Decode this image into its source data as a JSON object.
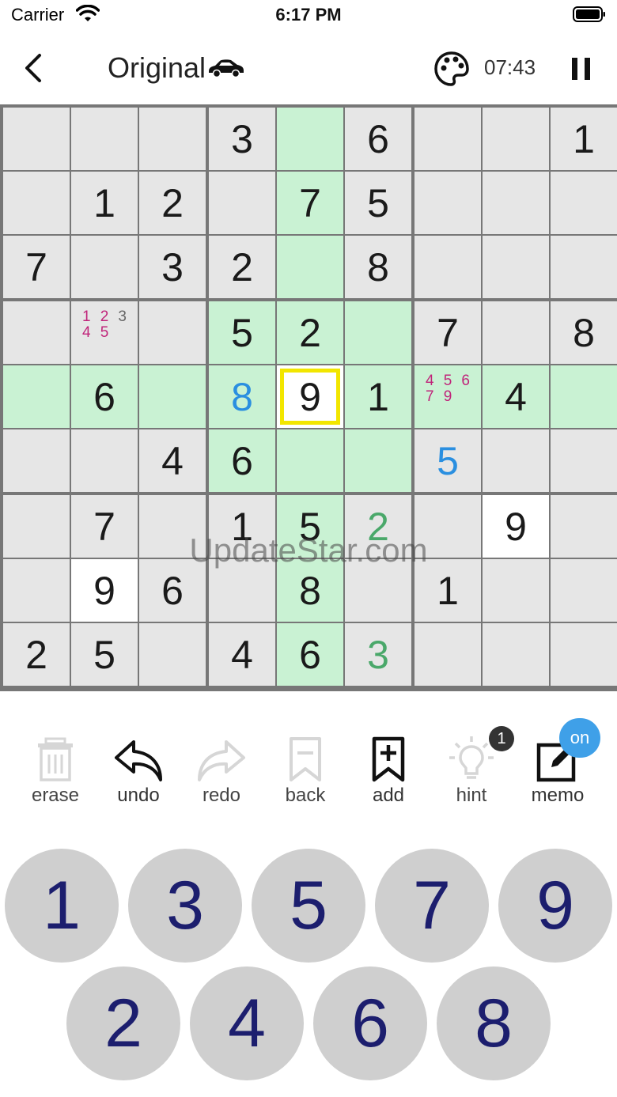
{
  "status_bar": {
    "carrier": "Carrier",
    "time": "6:17 PM"
  },
  "header": {
    "title": "Original",
    "timer": "07:43"
  },
  "board": {
    "rows": [
      [
        {
          "v": ""
        },
        {
          "v": ""
        },
        {
          "v": ""
        },
        {
          "v": "3"
        },
        {
          "v": ""
        },
        {
          "v": "6"
        },
        {
          "v": ""
        },
        {
          "v": ""
        },
        {
          "v": "1"
        }
      ],
      [
        {
          "v": ""
        },
        {
          "v": "1"
        },
        {
          "v": "2"
        },
        {
          "v": ""
        },
        {
          "v": "7"
        },
        {
          "v": "5"
        },
        {
          "v": ""
        },
        {
          "v": ""
        },
        {
          "v": ""
        }
      ],
      [
        {
          "v": "7"
        },
        {
          "v": ""
        },
        {
          "v": "3"
        },
        {
          "v": "2"
        },
        {
          "v": ""
        },
        {
          "v": "8"
        },
        {
          "v": ""
        },
        {
          "v": ""
        },
        {
          "v": ""
        }
      ],
      [
        {
          "v": ""
        },
        {
          "v": "",
          "notes": [
            "1",
            "2",
            "3",
            "4",
            "5"
          ]
        },
        {
          "v": ""
        },
        {
          "v": "5"
        },
        {
          "v": "2"
        },
        {
          "v": ""
        },
        {
          "v": "7"
        },
        {
          "v": ""
        },
        {
          "v": "8"
        }
      ],
      [
        {
          "v": ""
        },
        {
          "v": "6"
        },
        {
          "v": ""
        },
        {
          "v": "8",
          "c": "blue"
        },
        {
          "v": "9",
          "sel": true
        },
        {
          "v": "1"
        },
        {
          "v": "",
          "notes": [
            "4",
            "5",
            "6",
            "7",
            "9"
          ]
        },
        {
          "v": "4"
        },
        {
          "v": ""
        }
      ],
      [
        {
          "v": ""
        },
        {
          "v": ""
        },
        {
          "v": "4"
        },
        {
          "v": "6"
        },
        {
          "v": ""
        },
        {
          "v": ""
        },
        {
          "v": "5",
          "c": "blue"
        },
        {
          "v": ""
        },
        {
          "v": ""
        }
      ],
      [
        {
          "v": ""
        },
        {
          "v": "7"
        },
        {
          "v": ""
        },
        {
          "v": "1"
        },
        {
          "v": "5"
        },
        {
          "v": "2",
          "c": "green"
        },
        {
          "v": ""
        },
        {
          "v": "9",
          "w": true
        },
        {
          "v": ""
        }
      ],
      [
        {
          "v": ""
        },
        {
          "v": "9",
          "w": true
        },
        {
          "v": "6"
        },
        {
          "v": ""
        },
        {
          "v": "8"
        },
        {
          "v": ""
        },
        {
          "v": "1"
        },
        {
          "v": ""
        },
        {
          "v": ""
        }
      ],
      [
        {
          "v": "2"
        },
        {
          "v": "5"
        },
        {
          "v": ""
        },
        {
          "v": "4"
        },
        {
          "v": "6"
        },
        {
          "v": "3",
          "c": "green"
        },
        {
          "v": ""
        },
        {
          "v": ""
        },
        {
          "v": ""
        }
      ]
    ],
    "selected": {
      "row": 4,
      "col": 4
    },
    "colors": {
      "cell": "#e6e6e6",
      "highlight": "#c9f2d3",
      "white": "#ffffff",
      "selected_border": "#f2e600",
      "user_digit": "#2a8fe0",
      "hint_digit": "#4aa86a",
      "note": "#c0247a"
    }
  },
  "watermark": "UpdateStar.com",
  "toolbar": {
    "erase": "erase",
    "undo": "undo",
    "redo": "redo",
    "back": "back",
    "add": "add",
    "hint": "hint",
    "hint_count": "1",
    "memo": "memo",
    "memo_state": "on"
  },
  "numpad": {
    "row1": [
      "1",
      "3",
      "5",
      "7",
      "9"
    ],
    "row2": [
      "2",
      "4",
      "6",
      "8"
    ],
    "digit_color": "#1c1e6e"
  }
}
